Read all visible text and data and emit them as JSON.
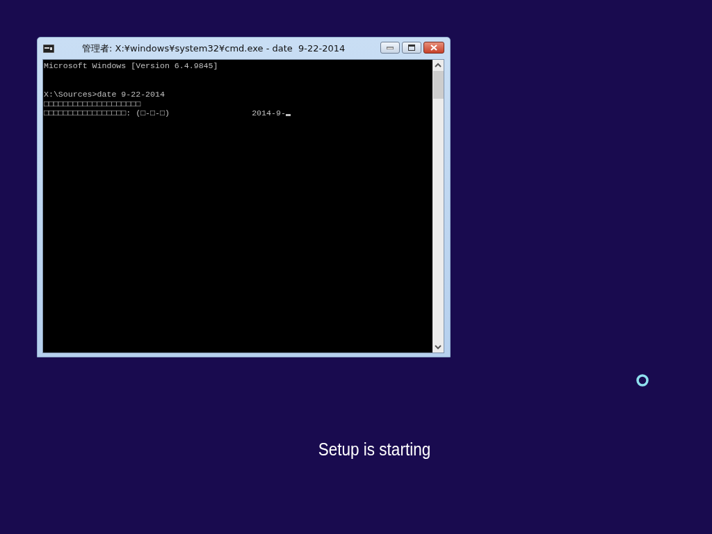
{
  "window": {
    "title": "管理者: X:¥windows¥system32¥cmd.exe - date  9-22-2014"
  },
  "console": {
    "blocks": [
      {
        "lines": [
          "Microsoft Windows [Version 6.4.9845]"
        ]
      },
      {
        "lines": [
          "X:\\Sources>date 9-22-2014",
          "□□□□□□□□□□□□□□□□□□□□",
          "□□□□□□□□□□□□□□□□□: (□-□-□)                 2014-9-"
        ]
      }
    ]
  },
  "setup": {
    "message": "Setup is starting"
  }
}
